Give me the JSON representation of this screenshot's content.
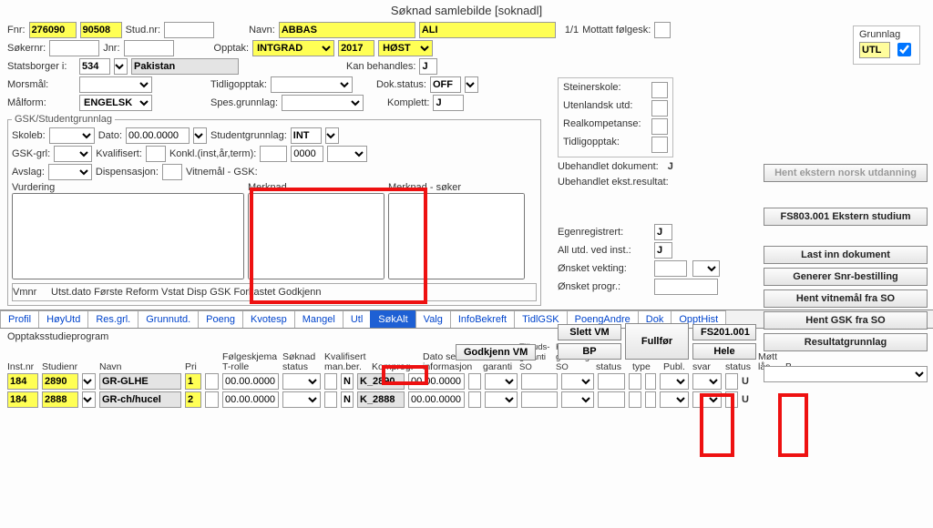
{
  "title": "Søknad samlebilde  [soknadl]",
  "top": {
    "fnr_lbl": "Fnr:",
    "fnr1": "276090",
    "fnr2": "90508",
    "studnr_lbl": "Stud.nr:",
    "navn_lbl": "Navn:",
    "navn1": "ABBAS",
    "navn2": "ALI",
    "count": "1/1",
    "mottatt_lbl": "Mottatt følgesk:",
    "grunnlag_lbl": "Grunnlag",
    "grunnlag_val": "UTL",
    "sokernr_lbl": "Søkernr:",
    "jnr_lbl": "Jnr:",
    "opptak_lbl": "Opptak:",
    "opptak_type": "INTGRAD",
    "opptak_year": "2017",
    "opptak_sem": "HØST",
    "statsborger_lbl": "Statsborger i:",
    "statsborger_kode": "534",
    "statsborger_navn": "Pakistan",
    "kanbeh_lbl": "Kan behandles:",
    "kanbeh_val": "J",
    "morsmal_lbl": "Morsmål:",
    "tidligopp_lbl": "Tidligopptak:",
    "dokstatus_lbl": "Dok.status:",
    "dokstatus_val": "OFF",
    "malform_lbl": "Målform:",
    "malform_val": "ENGELSK",
    "spesgr_lbl": "Spes.grunnlag:",
    "komplett_lbl": "Komplett:",
    "komplett_val": "J",
    "steiner_lbl": "Steinerskole:",
    "utenlutd_lbl": "Utenlandsk utd:",
    "realkomp_lbl": "Realkompetanse:",
    "tidligopp2_lbl": "Tidligopptak:",
    "ubehdok_lbl": "Ubehandlet dokument:",
    "ubehdok_val": "J",
    "ubehekst_lbl": "Ubehandlet ekst.resultat:",
    "egenreg_lbl": "Egenregistrert:",
    "egenreg_val": "J",
    "allutd_lbl": "All utd. ved inst.:",
    "allutd_val": "J",
    "onsketvek_lbl": "Ønsket vekting:",
    "onsketprg_lbl": "Ønsket progr.:"
  },
  "gsk": {
    "legend": "GSK/Studentgrunnlag",
    "skoleb_lbl": "Skoleb:",
    "dato_lbl": "Dato:",
    "dato_val": "00.00.0000",
    "studgr_lbl": "Studentgrunnlag:",
    "studgr_val": "INT",
    "gskgrl_lbl": "GSK-grl:",
    "kval_lbl": "Kvalifisert:",
    "konkl_lbl": "Konkl.(inst,år,term):",
    "konkl_year": "0000",
    "avslag_lbl": "Avslag:",
    "disp_lbl": "Dispensasjon:",
    "vitnemal_lbl": "Vitnemål - GSK:",
    "vurdering_lbl": "Vurdering",
    "merknad_lbl": "Merknad",
    "merksok_lbl": "Merknad - søker",
    "vmnr_lbl": "Vmnr",
    "vmnr_cols": "Utst.dato Første Reform Vstat Disp GSK Forkastet Godkjenn",
    "godkjennvm_btn": "Godkjenn VM",
    "slettvm_btn": "Slett VM",
    "bp_btn": "BP",
    "fullfor_btn": "Fullfør",
    "fs201_btn": "FS201.001",
    "hele_btn": "Hele"
  },
  "rightbtns": {
    "hentnorsk": "Hent ekstern norsk utdanning",
    "fs803": "FS803.001 Ekstern studium",
    "lastinn": "Last inn dokument",
    "gensnr": "Generer Snr-bestilling",
    "hentvitn": "Hent vitnemål fra SO",
    "hentgsk": "Hent GSK fra SO",
    "resgr": "Resultatgrunnlag"
  },
  "tabs": [
    "Profil",
    "HøyUtd",
    "Res.grl.",
    "Grunnutd.",
    "Poeng",
    "Kvotesp",
    "Mangel",
    "Utl",
    "SøkAlt",
    "Valg",
    "InfoBekreft",
    "TidlGSK",
    "PoengAndre",
    "Dok",
    "OpptHist"
  ],
  "grid": {
    "h_opptak": "Opptaksstudieprogram",
    "h_instnr": "Inst.nr",
    "h_studienr": "Studienr",
    "h_navn": "Navn",
    "h_pri": "Pri",
    "h_folge": "Følgeskjema",
    "h_trolle": "T-rolle",
    "h_sokstatus": "Søknad status",
    "h_kval": "Kvalifisert",
    "h_manber": "man.ber.",
    "h_kompreg": "Kompreg.",
    "h_datosendt": "Dato sendt informasjon",
    "h_tilbudgar": "Tilbud garanti",
    "h_tilbgarso": "Tilbuds-garanti SO",
    "h_kvalgrso": "Kval. grunnlag SO",
    "h_tilbstatus": "Tilbud status",
    "h_tilbtype": "Tilbud type",
    "h_publ": "Publ.",
    "h_tilbsvar": "Tilbud svar",
    "h_mottstatus": "Møtt status",
    "h_mottlas": "Møtt lås",
    "h_b": "B",
    "rows": [
      {
        "inst": "184",
        "stud": "2890",
        "navn": "GR-GLHE",
        "pri": "1",
        "trolle": "00.00.0000",
        "manN": "N",
        "kompreg": "K_2890",
        "dato": "00.00.0000",
        "u": "U"
      },
      {
        "inst": "184",
        "stud": "2888",
        "navn": "GR-ch/hucel",
        "pri": "2",
        "trolle": "00.00.0000",
        "manN": "N",
        "kompreg": "K_2888",
        "dato": "00.00.0000",
        "u": "U"
      }
    ]
  }
}
